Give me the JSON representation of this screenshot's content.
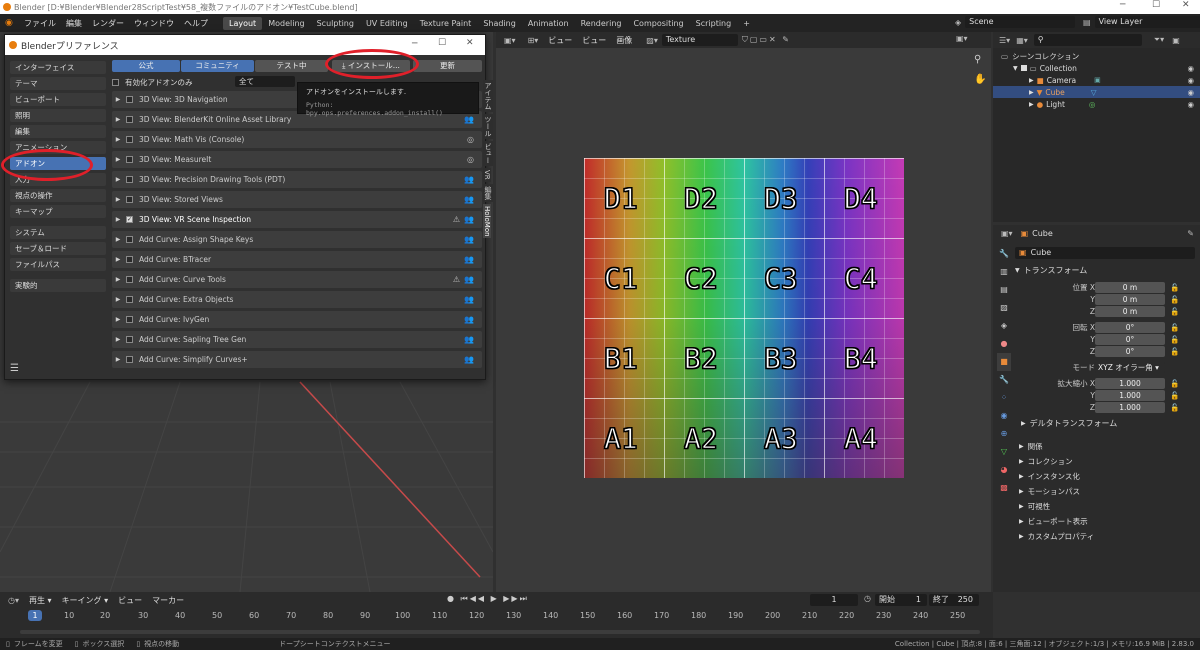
{
  "window_title": "Blender [D:¥Blender¥Blender28ScriptTest¥58_複数ファイルのアドオン¥TestCube.blend]",
  "menu": [
    "ファイル",
    "編集",
    "レンダー",
    "ウィンドウ",
    "ヘルプ"
  ],
  "workspaces": [
    "Layout",
    "Modeling",
    "Sculpting",
    "UV Editing",
    "Texture Paint",
    "Shading",
    "Animation",
    "Rendering",
    "Compositing",
    "Scripting"
  ],
  "scene": "Scene",
  "view_layer": "View Layer",
  "uv_header": {
    "view": "ビュー",
    "view2": "ビュー",
    "image": "画像",
    "texture": "Texture"
  },
  "uv_grid": {
    "rows": [
      [
        "D1",
        "D2",
        "D3",
        "D4"
      ],
      [
        "C1",
        "C2",
        "C3",
        "C4"
      ],
      [
        "B1",
        "B2",
        "B3",
        "B4"
      ],
      [
        "A1",
        "A2",
        "A3",
        "A4"
      ]
    ]
  },
  "side_tabs": [
    "アイテム",
    "ツール",
    "ビュー",
    "VR",
    "編集",
    "HoloMon"
  ],
  "prefs": {
    "title": "Blenderプリファレンス",
    "sidebar": [
      "インターフェイス",
      "テーマ",
      "ビューポート",
      "照明",
      "編集",
      "アニメーション",
      "アドオン",
      "入力",
      "視点の操作",
      "キーマップ",
      "システム",
      "セーブ＆ロード",
      "ファイルパス",
      "実験的"
    ],
    "tabs": [
      "公式",
      "コミュニティ",
      "テスト中"
    ],
    "install": "インストール...",
    "refresh": "更新",
    "enabled_only": "有効化アドオンのみ",
    "filter": "全て",
    "addons": [
      {
        "name": "3D View: 3D Navigation",
        "checked": false
      },
      {
        "name": "3D View: BlenderKit Online Asset Library",
        "checked": false
      },
      {
        "name": "3D View: Math Vis (Console)",
        "checked": false
      },
      {
        "name": "3D View: MeasureIt",
        "checked": false
      },
      {
        "name": "3D View: Precision Drawing Tools (PDT)",
        "checked": false
      },
      {
        "name": "3D View: Stored Views",
        "checked": false
      },
      {
        "name": "3D View: VR Scene Inspection",
        "checked": true
      },
      {
        "name": "Add Curve: Assign Shape Keys",
        "checked": false
      },
      {
        "name": "Add Curve: BTracer",
        "checked": false
      },
      {
        "name": "Add Curve: Curve Tools",
        "checked": false
      },
      {
        "name": "Add Curve: Extra Objects",
        "checked": false
      },
      {
        "name": "Add Curve: IvyGen",
        "checked": false
      },
      {
        "name": "Add Curve: Sapling Tree Gen",
        "checked": false
      },
      {
        "name": "Add Curve: Simplify Curves+",
        "checked": false
      }
    ],
    "tooltip": {
      "line1": "アドオンをインストールします.",
      "line2": "Python: bpy.ops.preferences.addon_install()"
    }
  },
  "outliner": {
    "collection": "シーンコレクション",
    "items": [
      "Collection",
      "Camera",
      "Cube",
      "Light"
    ]
  },
  "properties": {
    "object": "Cube",
    "object_field": "Cube",
    "transform": "トランスフォーム",
    "location": "位置 X",
    "rotation": "回転 X",
    "mode_label": "モード",
    "mode": "XYZ オイラー角",
    "scale": "拡大縮小 X",
    "y": "Y",
    "z": "Z",
    "loc": [
      "0 m",
      "0 m",
      "0 m"
    ],
    "rot": [
      "0°",
      "0°",
      "0°"
    ],
    "scl": [
      "1.000",
      "1.000",
      "1.000"
    ],
    "delta": "デルタトランスフォーム",
    "sections": [
      "関係",
      "コレクション",
      "インスタンス化",
      "モーションパス",
      "可視性",
      "ビューポート表示",
      "カスタムプロパティ"
    ]
  },
  "timeline": {
    "play": "再生",
    "keying": "キーイング",
    "view": "ビュー",
    "marker": "マーカー",
    "frame": "1",
    "start_label": "開始",
    "start": "1",
    "end_label": "終了",
    "end": "250",
    "ticks": [
      "1",
      "10",
      "20",
      "30",
      "40",
      "50",
      "60",
      "70",
      "80",
      "90",
      "100",
      "110",
      "120",
      "130",
      "140",
      "150",
      "160",
      "170",
      "180",
      "190",
      "200",
      "210",
      "220",
      "230",
      "240",
      "250"
    ]
  },
  "status": {
    "left1": "フレームを変更",
    "left2": "ボックス選択",
    "left3": "視点の移動",
    "mid": "ドープシートコンテクストメニュー",
    "right": "Collection | Cube | 頂点:8 | 面:6 | 三角面:12 | オブジェクト:1/3 | メモリ:16.9 MiB | 2.83.0"
  }
}
